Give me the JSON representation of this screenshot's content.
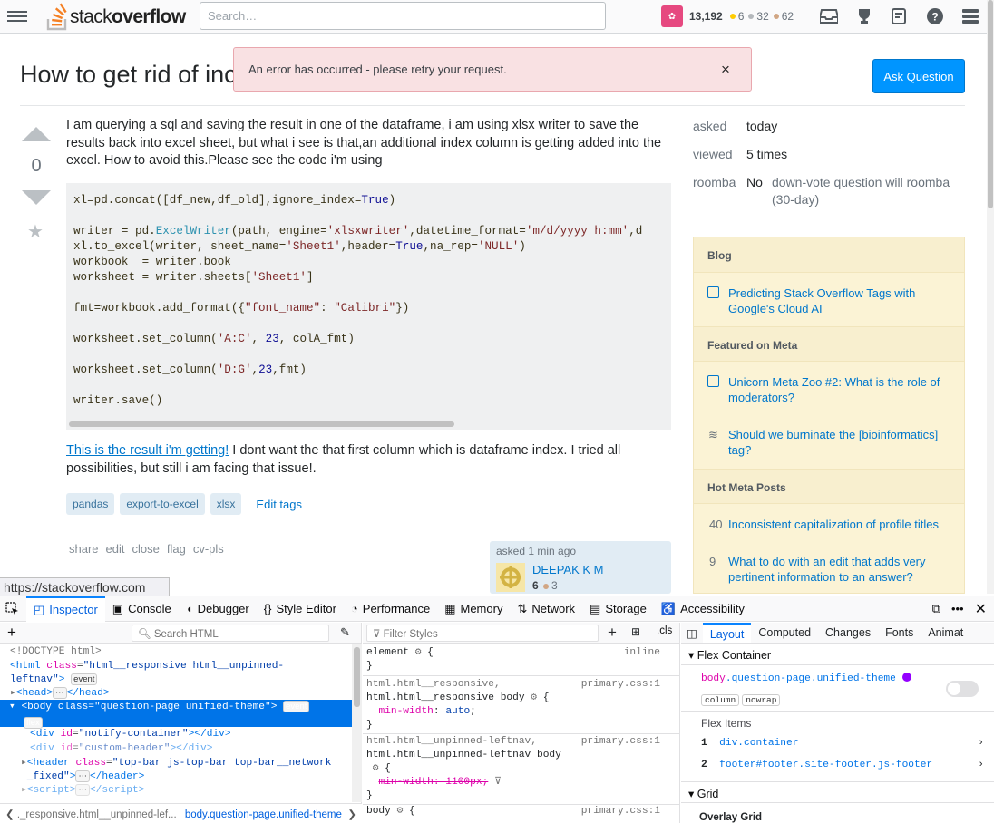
{
  "topbar": {
    "logo_text_1": "stack",
    "logo_text_2": "overflow",
    "search_placeholder": "Search…",
    "reputation": "13,192",
    "gold": "6",
    "silver": "32",
    "bronze": "62"
  },
  "question": {
    "title": "How to get rid of inc",
    "ask_button": "Ask Question",
    "votes": "0",
    "body_1": "I am querying a sql and saving the result in one of the dataframe, i am using xlsx writer to save the results back into excel sheet, but what i see is that,an additional index column is getting added into the excel. How to avoid this.Please see the code i'm using",
    "link_text": "This is the result i'm getting!",
    "body_2": " I dont want the that first column which is dataframe index. I tried all possibilities, but still i am facing that issue!.",
    "tags": [
      "pandas",
      "export-to-excel",
      "xlsx"
    ],
    "edit_tags": "Edit tags",
    "actions": [
      "share",
      "edit",
      "close",
      "flag",
      "cv-pls"
    ],
    "asked_label": "asked 1 min ago",
    "owner_name": "DEEPAK K M",
    "owner_rep": "6",
    "owner_bronze": "3"
  },
  "toast": {
    "message": "An error has occurred - please retry your request.",
    "close": "×"
  },
  "meta": {
    "asked_label": "asked",
    "asked_value": "today",
    "viewed_label": "viewed",
    "viewed_value": "5 times",
    "roomba_label": "roomba",
    "roomba_value": "No",
    "roomba_note": "down-vote question will roomba (30-day)"
  },
  "sidebar": {
    "blog_header": "Blog",
    "blog_item": "Predicting Stack Overflow Tags with Google's Cloud AI",
    "meta_header": "Featured on Meta",
    "meta_item_1": "Unicorn Meta Zoo #2: What is the role of moderators?",
    "meta_item_2": "Should we burninate the [bioinformatics] tag?",
    "hot_header": "Hot Meta Posts",
    "hot_1_count": "40",
    "hot_1": "Inconsistent capitalization of profile titles",
    "hot_2_count": "9",
    "hot_2": "What to do with an edit that adds very pertinent information to an answer?"
  },
  "status_url": "https://stackoverflow.com",
  "devtools": {
    "tabs": [
      "Inspector",
      "Console",
      "Debugger",
      "Style Editor",
      "Performance",
      "Memory",
      "Network",
      "Storage",
      "Accessibility"
    ],
    "search_html": "Search HTML",
    "filter_styles": "Filter Styles",
    "cls": ".cls",
    "right_tabs": [
      "Layout",
      "Computed",
      "Changes",
      "Fonts",
      "Animat"
    ],
    "flex_container": "Flex Container",
    "flex_selector_tag": "body",
    "flex_selector_cls": ".question-page.unified-theme",
    "pill_column": "column",
    "pill_nowrap": "nowrap",
    "flex_items_label": "Flex Items",
    "flex_item_1_num": "1",
    "flex_item_1": "div.container",
    "flex_item_2_num": "2",
    "flex_item_2": "footer#footer.site-footer.js-footer",
    "grid": "Grid",
    "overlay_grid": "Overlay Grid",
    "breadcrumb_1": "._responsive.html__unpinned-lef...",
    "breadcrumb_2": "body.question-page.unified-theme",
    "event_badge": "event",
    "flex_badge": "flex",
    "source": "primary.css:1",
    "inline": "inline"
  }
}
